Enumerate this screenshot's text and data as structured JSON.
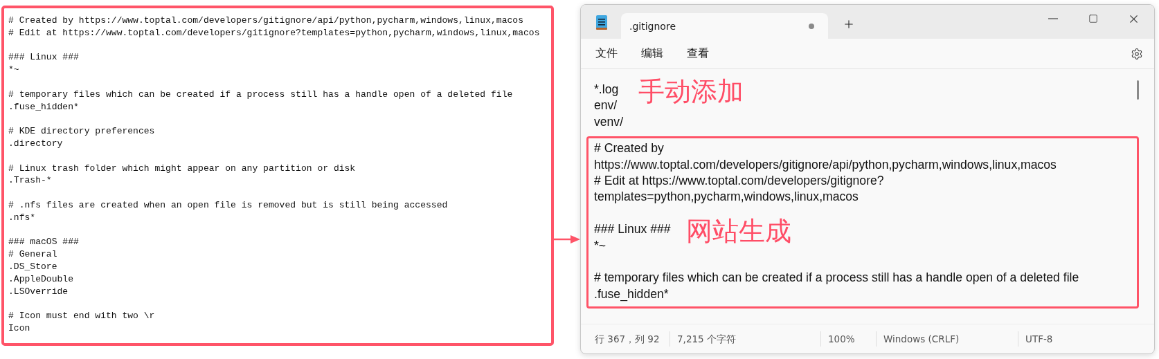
{
  "left_editor": {
    "blocks": [
      [
        "# Created by https://www.toptal.com/developers/gitignore/api/python,pycharm,windows,linux,macos",
        "# Edit at https://www.toptal.com/developers/gitignore?templates=python,pycharm,windows,linux,macos"
      ],
      [
        "### Linux ###",
        "*~"
      ],
      [
        "# temporary files which can be created if a process still has a handle open of a deleted file",
        ".fuse_hidden*"
      ],
      [
        "# KDE directory preferences",
        ".directory"
      ],
      [
        "# Linux trash folder which might appear on any partition or disk",
        ".Trash-*"
      ],
      [
        "# .nfs files are created when an open file is removed but is still being accessed",
        ".nfs*"
      ],
      [
        "### macOS ###",
        "# General",
        ".DS_Store",
        ".AppleDouble",
        ".LSOverride"
      ],
      [
        "# Icon must end with two \\r",
        "Icon"
      ]
    ]
  },
  "notepad": {
    "tabs": [
      {
        "label": ".gitignore",
        "selected": true,
        "modified": true
      }
    ],
    "menu": [
      "文件",
      "编辑",
      "查看"
    ],
    "editor": {
      "sections": [
        {
          "highlighted": false,
          "blocks": [
            {
              "lines": [
                "*.log",
                "env/",
                "venv/"
              ],
              "annotation": "手动添加"
            }
          ]
        },
        {
          "highlighted": true,
          "blocks": [
            {
              "lines": [
                "# Created by",
                "https://www.toptal.com/developers/gitignore/api/python,pycharm,windows,linux,macos",
                "# Edit at https://www.toptal.com/developers/gitignore?",
                "templates=python,pycharm,windows,linux,macos"
              ]
            },
            {
              "lines": [
                "### Linux ###",
                "*~"
              ],
              "annotation": "网站生成"
            },
            {
              "lines": [
                "# temporary files which can be created if a process still has a handle open of a deleted file",
                ".fuse_hidden*"
              ]
            }
          ]
        }
      ]
    },
    "status_bar": [
      "行 367，列 92",
      "7,215 个字符",
      "100%",
      "Windows (CRLF)",
      "UTF-8"
    ]
  }
}
